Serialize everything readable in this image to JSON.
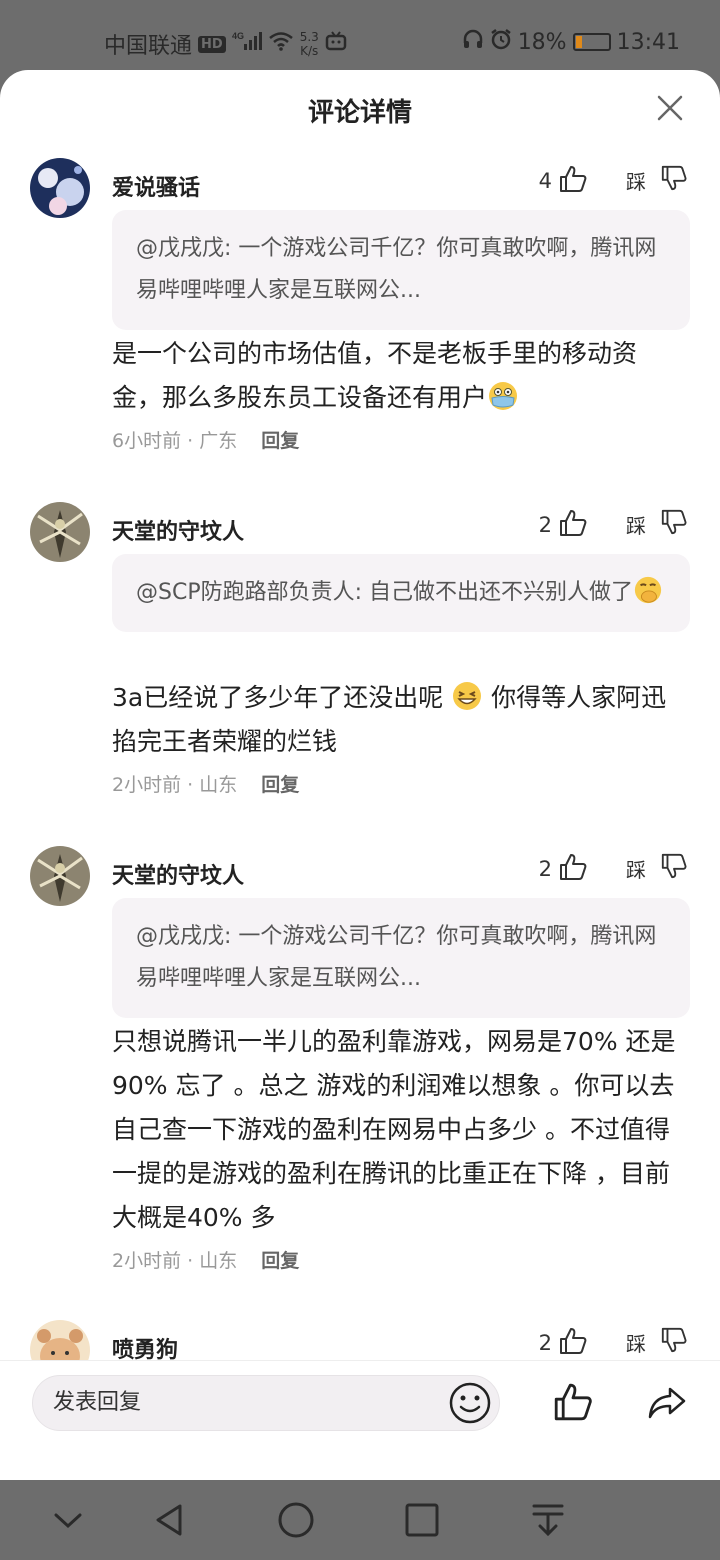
{
  "status_bar": {
    "carrier": "中国联通",
    "hd_badge": "HD",
    "network_type": "4G",
    "net_speed_value": "5.3",
    "net_speed_unit": "K/s",
    "battery_percent": "18%",
    "battery_level": 0.18,
    "time": "13:41"
  },
  "sheet": {
    "title": "评论详情",
    "close_icon": "close-icon"
  },
  "comments": [
    {
      "username": "爱说骚话",
      "likes": "4",
      "dislike_label": "踩",
      "quote": "@戊戌戊: 一个游戏公司千亿？你可真敢吹啊，腾讯网易哔哩哔哩人家是互联网公...",
      "body": "是一个公司的市场估值，不是老板手里的移动资金，那么多股东员工设备还有用户",
      "body_emoji": "flushed-mask-emoji",
      "time": "6小时前",
      "location": "广东",
      "reply_label": "回复"
    },
    {
      "username": "天堂的守坟人",
      "likes": "2",
      "dislike_label": "踩",
      "quote": "@SCP防跑路部负责人: 自己做不出还不兴别人做了",
      "quote_emoji": "hand-over-mouth-emoji",
      "body_before": "3a已经说了多少年了还没出呢",
      "body_emoji": "grinning-squint-emoji",
      "body_after": "你得等人家阿迅掐完王者荣耀的烂钱",
      "time": "2小时前",
      "location": "山东",
      "reply_label": "回复"
    },
    {
      "username": "天堂的守坟人",
      "likes": "2",
      "dislike_label": "踩",
      "quote": "@戊戌戊: 一个游戏公司千亿？你可真敢吹啊，腾讯网易哔哩哔哩人家是互联网公...",
      "body": "只想说腾讯一半儿的盈利靠游戏，网易是70% 还是90% 忘了 。总之 游戏的利润难以想象 。你可以去自己查一下游戏的盈利在网易中占多少 。不过值得一提的是游戏的盈利在腾讯的比重正在下降 ，目前大概是40% 多",
      "time": "2小时前",
      "location": "山东",
      "reply_label": "回复"
    },
    {
      "username": "喷勇狗",
      "likes": "2",
      "dislike_label": "踩"
    }
  ],
  "input_bar": {
    "placeholder": "发表回复"
  },
  "nav_bar": {
    "buttons": [
      "collapse-icon",
      "back-icon",
      "home-icon",
      "recents-icon",
      "notification-pulldown-icon"
    ]
  }
}
